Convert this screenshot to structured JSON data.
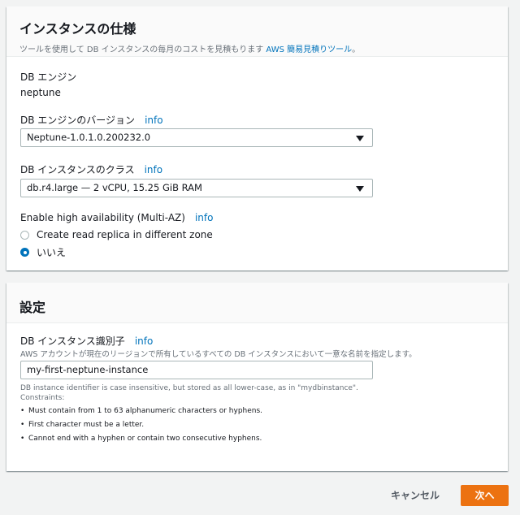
{
  "spec_panel": {
    "title": "インスタンスの仕様",
    "desc_prefix": "ツールを使用して DB インスタンスの毎月のコストを見積もります ",
    "desc_link": "AWS 簡易見積りツール",
    "desc_suffix": "。",
    "engine_label": "DB エンジン",
    "engine_value": "neptune",
    "version_label": "DB エンジンのバージョン",
    "version_info": "info",
    "version_value": "Neptune-1.0.1.0.200232.0",
    "class_label": "DB インスタンスのクラス",
    "class_info": "info",
    "class_value": "db.r4.large — 2 vCPU, 15.25 GiB RAM",
    "ha_label": "Enable high availability (Multi-AZ)",
    "ha_info": "info",
    "ha_options": [
      {
        "label": "Create read replica in different zone",
        "checked": false
      },
      {
        "label": "いいえ",
        "checked": true
      }
    ]
  },
  "settings_panel": {
    "title": "設定",
    "id_label": "DB インスタンス識別子",
    "id_info": "info",
    "id_desc": "AWS アカウントが現在のリージョンで所有しているすべての DB インスタンスにおいて一意な名前を指定します。",
    "id_value": "my-first-neptune-instance",
    "hint": "DB instance identifier is case insensitive, but stored as all lower-case, as in \"mydbinstance\".",
    "constraints_title": "Constraints:",
    "constraints": [
      "Must contain from 1 to 63 alphanumeric characters or hyphens.",
      "First character must be a letter.",
      "Cannot end with a hyphen or contain two consecutive hyphens."
    ]
  },
  "footer": {
    "cancel_label": "キャンセル",
    "next_label": "次へ"
  }
}
